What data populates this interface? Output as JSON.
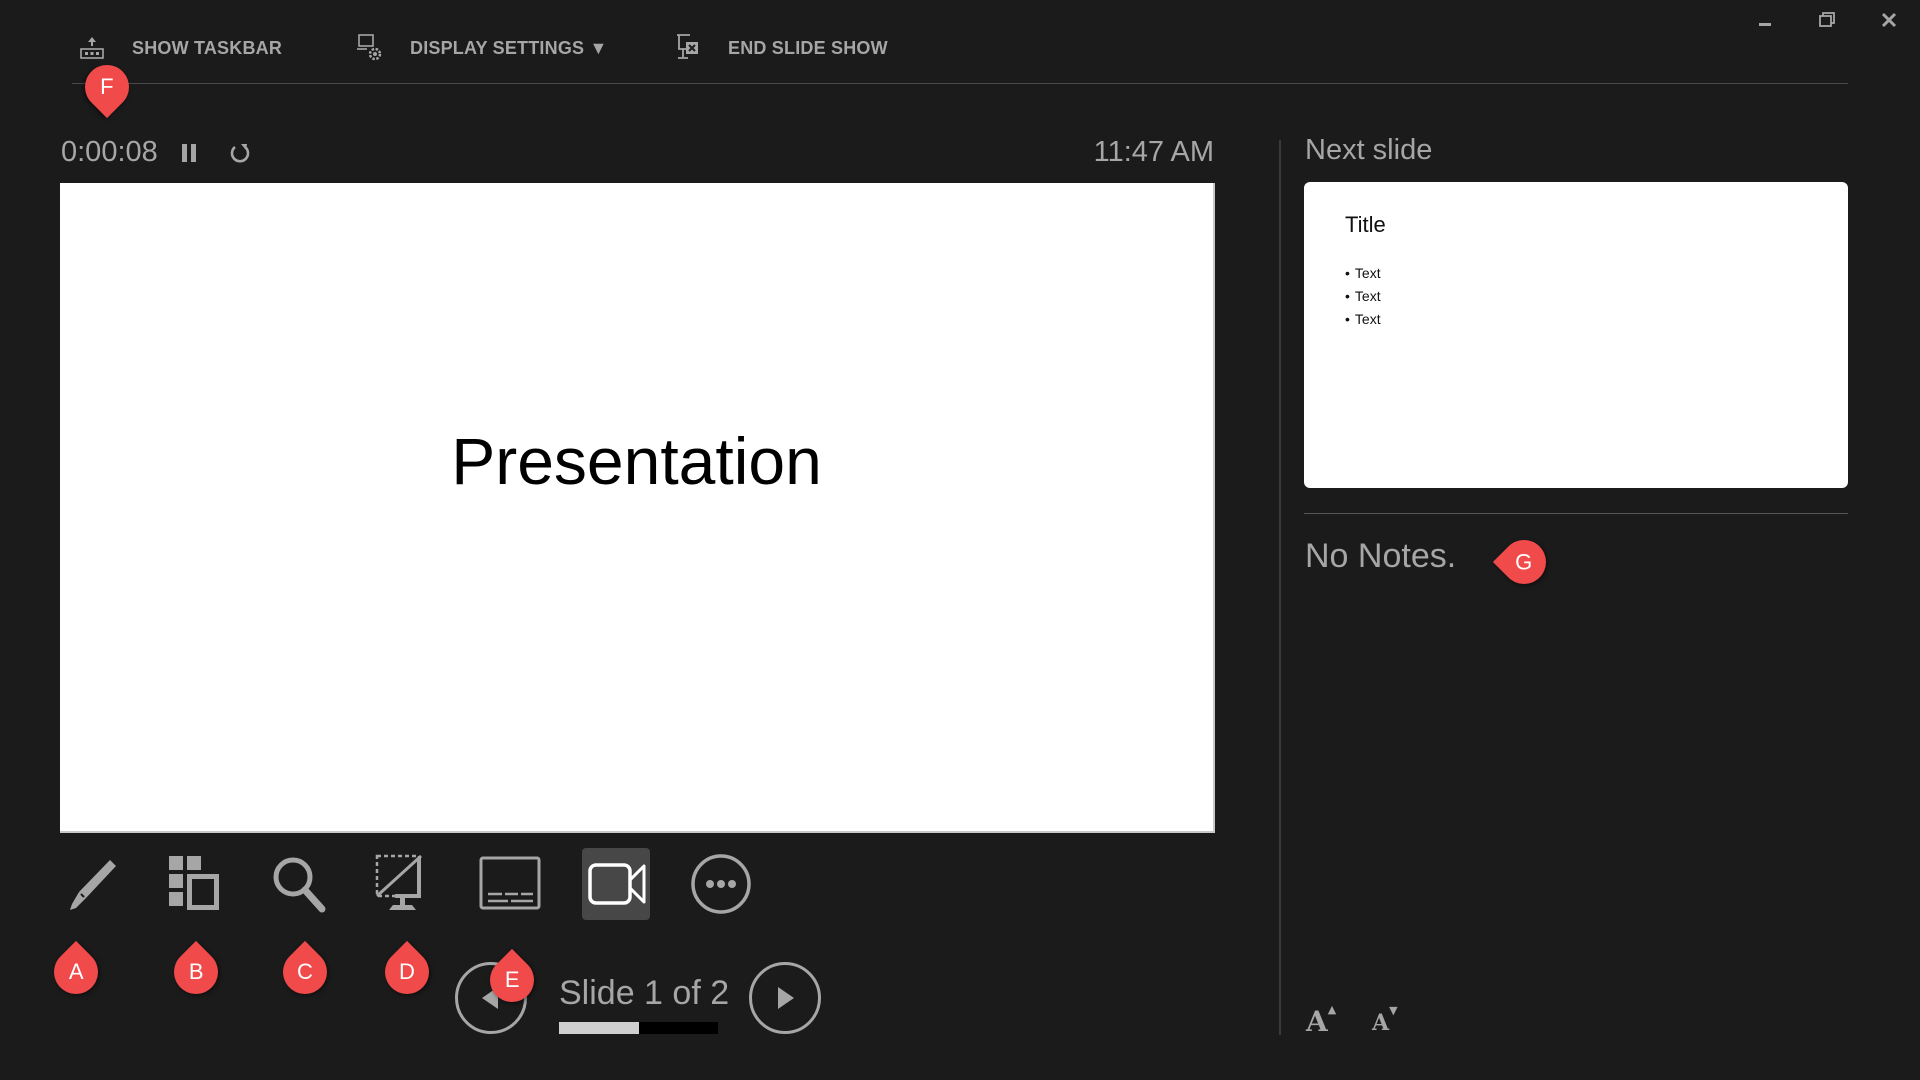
{
  "toolbar": {
    "show_taskbar": "SHOW TASKBAR",
    "display_settings": "DISPLAY SETTINGS ▼",
    "end_slide_show": "END SLIDE SHOW"
  },
  "window_controls": [
    "minimize",
    "restore",
    "close"
  ],
  "timer": {
    "elapsed": "0:00:08",
    "clock": "11:47 AM"
  },
  "current_slide": {
    "title": "Presentation"
  },
  "tools": [
    {
      "name": "pen-tool",
      "icon": "pen-icon"
    },
    {
      "name": "see-all-slides",
      "icon": "slides-grid-icon"
    },
    {
      "name": "zoom-into-slide",
      "icon": "magnifier-icon"
    },
    {
      "name": "black-or-unblack-slide",
      "icon": "screen-off-icon"
    },
    {
      "name": "toggle-subtitles",
      "icon": "subtitles-icon"
    },
    {
      "name": "toggle-camera",
      "icon": "camera-icon",
      "active": true
    },
    {
      "name": "more-options",
      "icon": "ellipsis-icon"
    }
  ],
  "navigation": {
    "counter": "Slide 1 of 2",
    "current": 1,
    "total": 2,
    "progress": 0.5
  },
  "next_slide": {
    "label": "Next slide",
    "title": "Title",
    "bullets": [
      "Text",
      "Text",
      "Text"
    ]
  },
  "notes": {
    "text": "No Notes."
  },
  "font_controls": {
    "increase": "A",
    "decrease": "A"
  },
  "annotations": {
    "A": "A",
    "B": "B",
    "C": "C",
    "D": "D",
    "E": "E",
    "F": "F",
    "G": "G",
    "color": "#f04a4a"
  }
}
